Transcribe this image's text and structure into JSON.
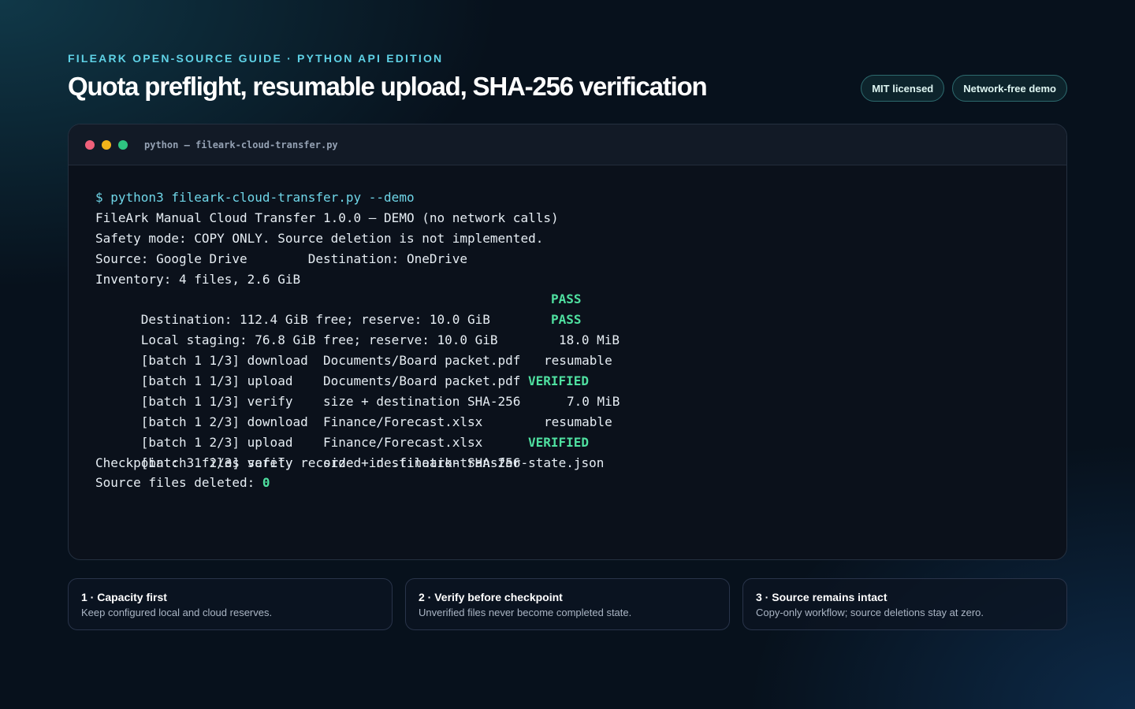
{
  "header": {
    "eyebrow": "FILEARK OPEN-SOURCE GUIDE · PYTHON API EDITION",
    "title": "Quota preflight, resumable upload, SHA-256 verification",
    "badges": [
      "MIT licensed",
      "Network-free demo"
    ]
  },
  "terminal": {
    "window_title": "python — fileark-cloud-transfer.py",
    "command": "$ python3 fileark-cloud-transfer.py --demo",
    "lines": [
      "FileArk Manual Cloud Transfer 1.0.0 — DEMO (no network calls)",
      "Safety mode: COPY ONLY. Source deletion is not implemented.",
      "Source: Google Drive        Destination: OneDrive",
      "Inventory: 4 files, 2.6 GiB",
      "Destination: 112.4 GiB free; reserve: 10.0 GiB",
      "Local staging: 76.8 GiB free; reserve: 10.0 GiB",
      "[batch 1 1/3] download  Documents/Board packet.pdf",
      "[batch 1 1/3] upload    Documents/Board packet.pdf",
      "[batch 1 1/3] verify    size + destination SHA-256",
      "[batch 1 2/3] download  Finance/Forecast.xlsx",
      "[batch 1 2/3] upload    Finance/Forecast.xlsx",
      "[batch 1 2/3] verify    size + destination SHA-256",
      "Checkpoint: 3 files safely recorded in .fileark-transfer-state.json",
      "Source files deleted: "
    ],
    "statuses": {
      "dest_check": "PASS",
      "local_check": "PASS",
      "download_1_size": "18.0 MiB",
      "upload_1": "resumable",
      "verify_1": "VERIFIED",
      "download_2_size": "7.0 MiB",
      "upload_2": "resumable",
      "verify_2": "VERIFIED",
      "deleted_count": "0"
    }
  },
  "cards": [
    {
      "title": "1 · Capacity first",
      "text": "Keep configured local and cloud reserves."
    },
    {
      "title": "2 · Verify before checkpoint",
      "text": "Unverified files never become completed state."
    },
    {
      "title": "3 · Source remains intact",
      "text": "Copy-only workflow; source deletions stay at zero."
    }
  ],
  "colors": {
    "accent_cyan": "#5fd2e6",
    "status_green": "#4fe0a0",
    "dot_red": "#f0607a",
    "dot_yellow": "#f3b41a",
    "dot_green": "#2ec581"
  }
}
